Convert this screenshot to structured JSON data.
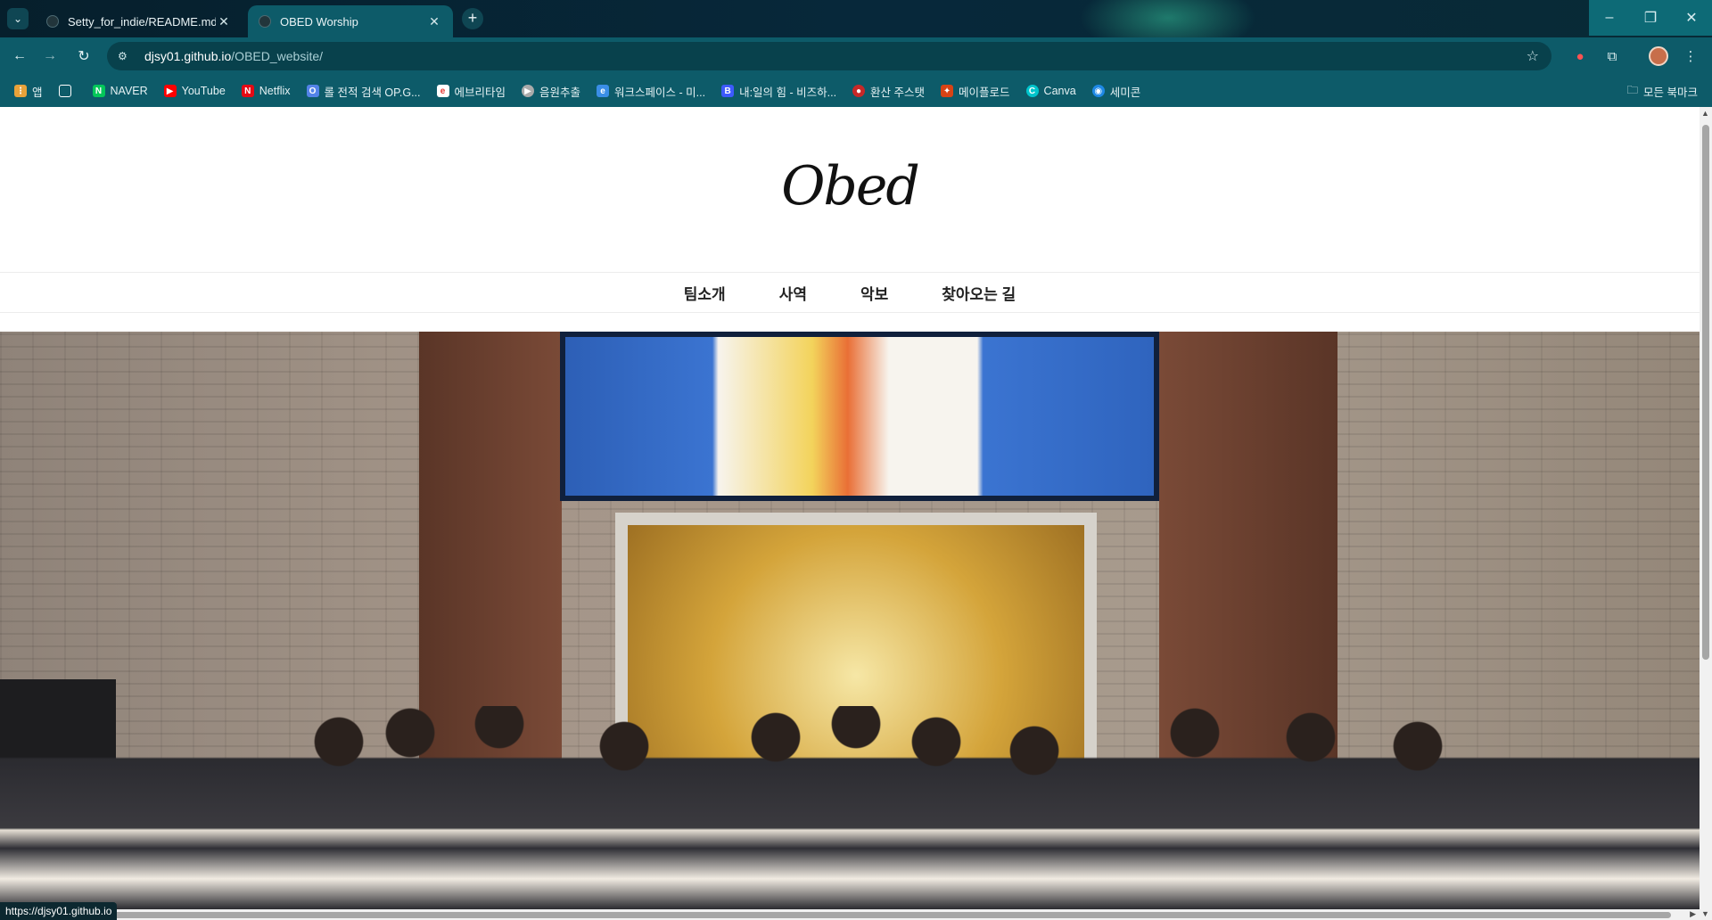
{
  "browser": {
    "tabs": [
      {
        "title": "Setty_for_indie/README.md at",
        "active": false
      },
      {
        "title": "OBED Worship",
        "active": true
      }
    ],
    "url_host": "djsy01.github.io",
    "url_path": "/OBED_website/",
    "status_url": "https://djsy01.github.io",
    "bookmarks": [
      {
        "label": "앱",
        "icon": "apps-icon",
        "color": "#e8a23a"
      },
      {
        "label": "",
        "icon": "grid-icon",
        "color": "#ffffff"
      },
      {
        "label": "NAVER",
        "icon": "naver-icon",
        "color": "#03c75a"
      },
      {
        "label": "YouTube",
        "icon": "youtube-icon",
        "color": "#ff0000"
      },
      {
        "label": "Netflix",
        "icon": "netflix-icon",
        "color": "#e50914"
      },
      {
        "label": "롤 전적 검색 OP.G...",
        "icon": "opgg-icon",
        "color": "#5383e8"
      },
      {
        "label": "에브리타임",
        "icon": "everytime-icon",
        "color": "#e53935"
      },
      {
        "label": "음원추출",
        "icon": "play-icon",
        "color": "#aaaaaa"
      },
      {
        "label": "워크스페이스 - 미...",
        "icon": "workspace-icon",
        "color": "#3a8ee6"
      },
      {
        "label": "내:일의 힘 - 비즈하...",
        "icon": "b-icon",
        "color": "#3d5afe"
      },
      {
        "label": "환산 주스탯",
        "icon": "red-circle-icon",
        "color": "#c62828"
      },
      {
        "label": "메이플로드",
        "icon": "maple-icon",
        "color": "#d84315"
      },
      {
        "label": "Canva",
        "icon": "canva-icon",
        "color": "#00c4cc"
      },
      {
        "label": "세미콘",
        "icon": "semicon-icon",
        "color": "#1e88e5"
      }
    ],
    "all_bookmarks": "모든 북마크"
  },
  "site": {
    "logo_text": "Obed",
    "nav": [
      "팀소개",
      "사역",
      "악보",
      "찾아오는 길"
    ]
  }
}
